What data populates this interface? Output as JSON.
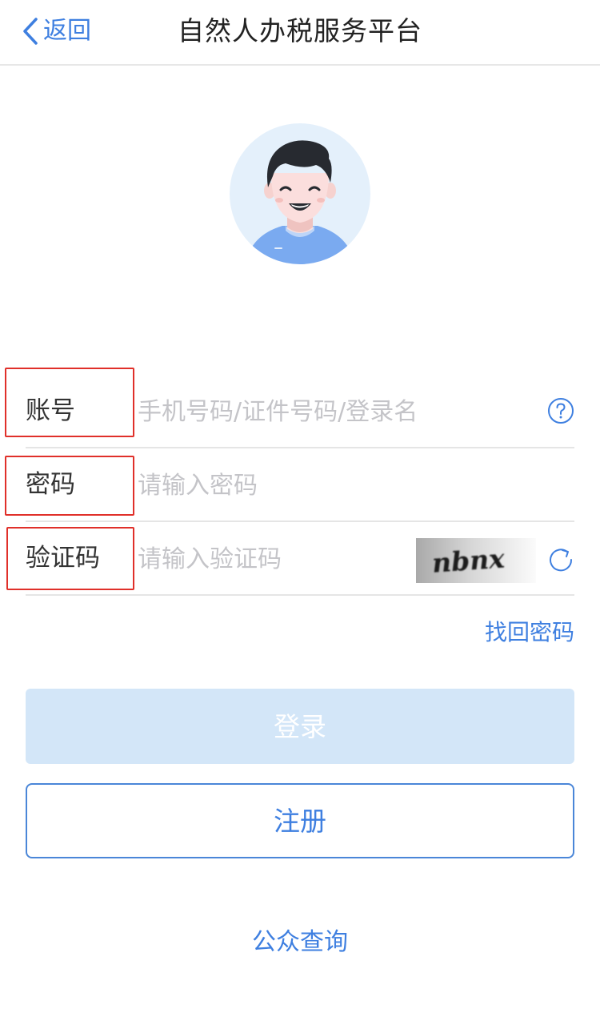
{
  "nav": {
    "back_label": "返回",
    "title": "自然人办税服务平台"
  },
  "form": {
    "account": {
      "label": "账号",
      "placeholder": "手机号码/证件号码/登录名",
      "value": ""
    },
    "password": {
      "label": "密码",
      "placeholder": "请输入密码",
      "value": ""
    },
    "captcha": {
      "label": "验证码",
      "placeholder": "请输入验证码",
      "value": "",
      "image_text": "nbnx"
    },
    "forgot_password": "找回密码"
  },
  "buttons": {
    "login": "登录",
    "register": "注册"
  },
  "footer": {
    "public_query": "公众查询"
  },
  "icons": {
    "back": "chevron-left-icon",
    "help": "question-circle-icon",
    "refresh": "refresh-icon"
  },
  "colors": {
    "accent": "#3e7fe0",
    "login_disabled_bg": "#d3e6f8",
    "highlight_border": "#e0302a",
    "avatar_bg": "#e4f0fb",
    "shirt": "#7aaaf0"
  }
}
